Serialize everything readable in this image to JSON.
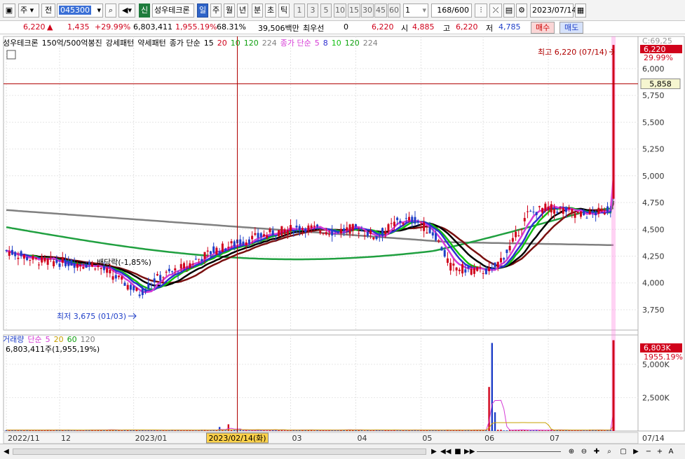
{
  "toolbar": {
    "type_select": "주",
    "type_sel2": "전",
    "code": "045300",
    "badge": "신",
    "stock_name": "성우테크론",
    "periods": [
      "일",
      "주",
      "월",
      "년",
      "분",
      "초",
      "틱"
    ],
    "active_period": "일",
    "intervals": [
      "1",
      "3",
      "5",
      "10",
      "15",
      "30",
      "45",
      "60"
    ],
    "interval_input": "1",
    "count": "168",
    "count_total": "/600",
    "date": "2023/07/14"
  },
  "quote": {
    "price": "6,220",
    "change": "1,435",
    "change_pct": "+29.99%",
    "volume": "6,803,411",
    "volume_pct": "1,955.19%",
    "turnover_pct": "68.31%",
    "amount": "39,506백만",
    "priority_label": "최우선",
    "priority_val": "0",
    "ask_price": "6,220",
    "open_label": "시",
    "open": "4,885",
    "high_label": "고",
    "high": "6,220",
    "low_label": "저",
    "low": "4,785",
    "buy_label": "매수",
    "sell_label": "매도"
  },
  "legend": {
    "name": "성우테크론",
    "item2": "150억/500억봉진",
    "item3": "강세패턴",
    "item4": "약세패턴",
    "ma1_label": "종가 단순",
    "ma1_vals": [
      "15",
      "20",
      "10",
      "120",
      "224"
    ],
    "ma2_label": "종가 단순",
    "ma2_vals": [
      "5",
      "8",
      "10",
      "120",
      "224"
    ]
  },
  "volume_legend": {
    "label": "거래량",
    "ma_label": "단순",
    "vals": [
      "5",
      "20",
      "60",
      "120"
    ],
    "value": "6,803,411주(1,955,19%)"
  },
  "annotations": {
    "high": "최고 6,220 (07/14)",
    "low": "최저 3,675 (01/03)",
    "dividend": "배당락(-1,85%)",
    "cursor_date": "2023/02/14(화)",
    "cursor_price": "5,858",
    "last_price": "6,220",
    "last_pct": "29.99%",
    "price_top": "C:69,25",
    "vol_last": "6,803K",
    "vol_pct": "1955.19%"
  },
  "chart_data": {
    "type": "candlestick",
    "price_axis": [
      "6,000",
      "5,750",
      "5,500",
      "5,250",
      "5,000",
      "4,750",
      "4,500",
      "4,250",
      "4,000",
      "3,750"
    ],
    "price_ticks": [
      6000,
      5750,
      5500,
      5250,
      5000,
      4750,
      4500,
      4250,
      4000,
      3750
    ],
    "price_range": [
      3560,
      6300
    ],
    "volume_axis": [
      "5,000K",
      "2,500K"
    ],
    "volume_ticks": [
      5000,
      2500
    ],
    "volume_range": [
      0,
      7200
    ],
    "x_labels": [
      "2022/11",
      "12",
      "2023/01",
      "03",
      "04",
      "05",
      "06",
      "07",
      "07/14"
    ],
    "x_label_index": [
      0,
      18,
      43,
      96,
      118,
      140,
      161,
      183,
      205
    ],
    "high": 6220,
    "low": 3675,
    "cursor_price": 5858,
    "candles": [],
    "volumes": []
  },
  "colors": {
    "up": "#d0021b",
    "down": "#1f3fc8",
    "ma_magenta": "#d63cd6",
    "ma_blue": "#2f2fd0",
    "ma_green": "#10c010",
    "ma_black": "#000000",
    "ma_darkred": "#7a1010",
    "ma_long": "#20a040",
    "ma_longest": "#808080"
  }
}
